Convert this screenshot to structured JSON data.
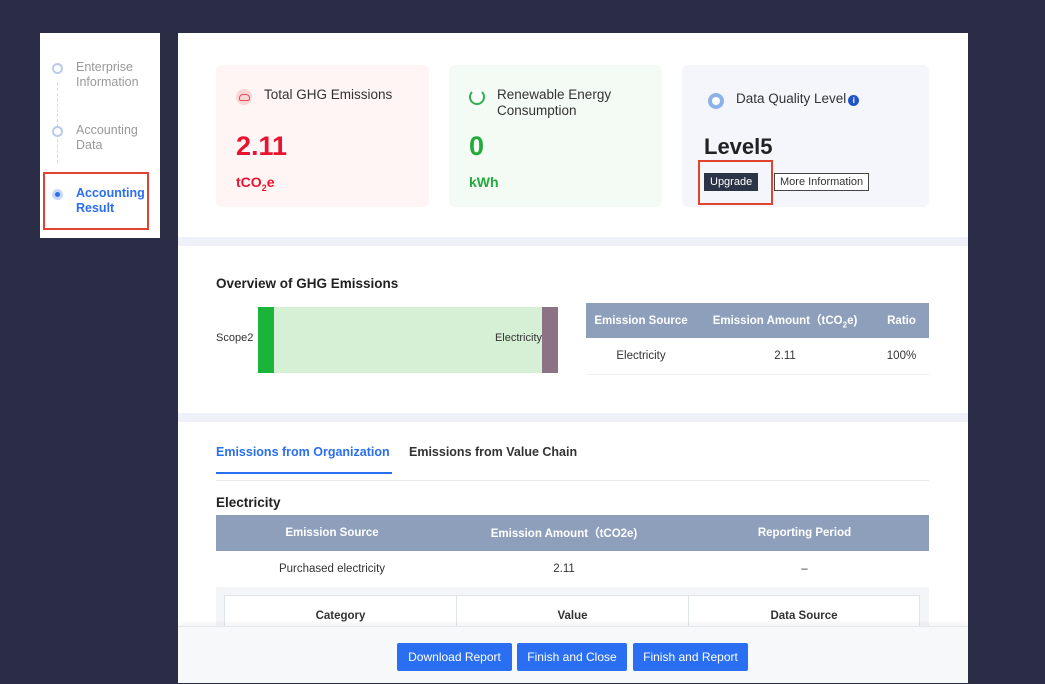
{
  "sidebar": {
    "steps": [
      {
        "line1": "Enterprise",
        "line2": "Information"
      },
      {
        "line1": "Accounting",
        "line2": "Data"
      },
      {
        "line1": "Accounting",
        "line2": "Result"
      }
    ],
    "active_index": 2
  },
  "cards": {
    "ghg": {
      "title": "Total GHG Emissions",
      "value": "2.11",
      "unit_main": "tCO",
      "unit_sub": "2",
      "unit_tail": "e",
      "icon": "cloud-icon",
      "color": "#e8142f"
    },
    "renewable": {
      "title": "Renewable Energy Consumption",
      "value": "0",
      "unit": "kWh",
      "icon": "recycle-icon",
      "color": "#22aa3b"
    },
    "quality": {
      "title": "Data Quality Level",
      "info": "i",
      "value": "Level5",
      "upgrade_label": "Upgrade",
      "more_label": "More Information",
      "icon": "medal-icon"
    }
  },
  "overview": {
    "title": "Overview of GHG Emissions",
    "sankey": {
      "left_label": "Scope2",
      "right_label": "Electricity"
    },
    "table": {
      "headers": [
        "Emission Source",
        "Emission Amount（tCO",
        "2",
        "e)",
        "Ratio"
      ],
      "rows": [
        [
          "Electricity",
          "2.11",
          "100%"
        ]
      ]
    }
  },
  "tabs": [
    "Emissions from Organization",
    "Emissions from Value Chain"
  ],
  "electricity": {
    "title": "Electricity",
    "headers": [
      "Emission Source",
      "Emission Amount（tCO2e)",
      "Reporting Period"
    ],
    "rows": [
      [
        "Purchased electricity",
        "2.11",
        "–"
      ]
    ],
    "sub_headers": [
      "Category",
      "Value",
      "Data Source"
    ]
  },
  "footer": {
    "download": "Download Report",
    "finish_close": "Finish and Close",
    "finish_report": "Finish and Report"
  },
  "colors": {
    "accent": "#2a6ef2",
    "highlight_box": "#e0432e",
    "table_header": "#8e9fbc"
  }
}
